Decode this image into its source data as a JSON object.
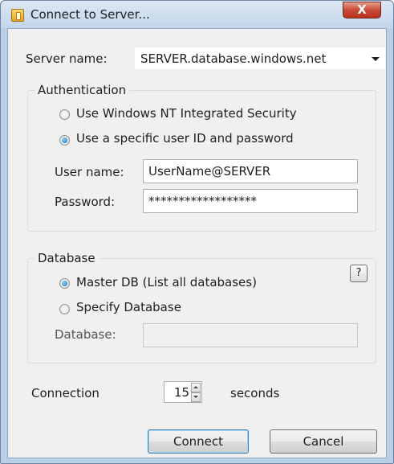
{
  "window": {
    "title": "Connect to Server...",
    "close_label": "X"
  },
  "server": {
    "label": "Server name:",
    "value": "SERVER.database.windows.net"
  },
  "authentication": {
    "group_title": "Authentication",
    "option_windows": "Use Windows NT Integrated Security",
    "option_specific": "Use a specific user ID and password",
    "selected": "specific",
    "username_label": "User name:",
    "username_value": "UserName@SERVER",
    "password_label": "Password:",
    "password_value": "******************"
  },
  "database": {
    "group_title": "Database",
    "option_master": "Master DB (List all databases)",
    "option_specify": "Specify Database",
    "selected": "master",
    "database_label": "Database:",
    "database_value": "",
    "help_label": "?"
  },
  "connection": {
    "label": "Connection",
    "timeout_value": "15",
    "unit": "seconds"
  },
  "buttons": {
    "connect": "Connect",
    "cancel": "Cancel"
  },
  "icons": {
    "app_icon": "database-icon",
    "close_icon": "close-icon",
    "dropdown_icon": "chevron-down-icon",
    "help_icon": "help-icon"
  },
  "colors": {
    "title_bar": "#c3d6ea",
    "close_button": "#c94a36",
    "dialog_background": "#f0f0f0",
    "default_button_border": "#3c7fb1",
    "radio_checked": "#1d6fb6"
  }
}
